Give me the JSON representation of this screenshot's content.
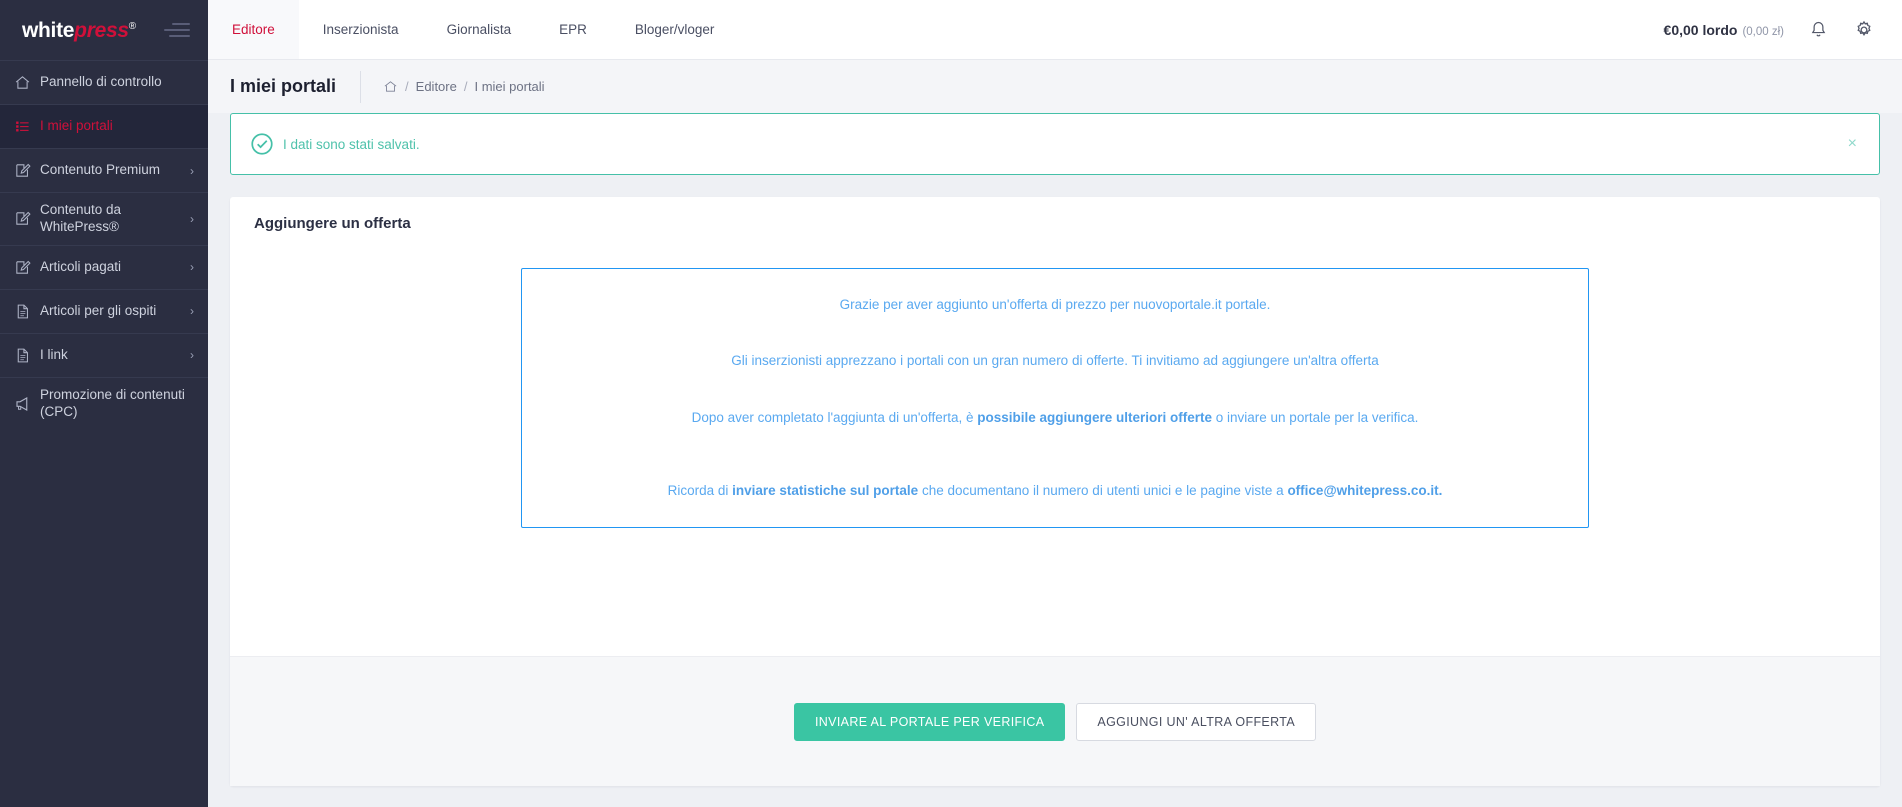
{
  "brand": {
    "name_white": "white",
    "name_red": "press",
    "reg": "®"
  },
  "sidebar": {
    "items": [
      {
        "label": "Pannello di controllo",
        "icon": "home-icon",
        "chevron": "",
        "active": false
      },
      {
        "label": "I miei portali",
        "icon": "list-icon",
        "chevron": "",
        "active": true
      },
      {
        "label": "Contenuto Premium",
        "icon": "edit-document-icon",
        "chevron": "›",
        "active": false
      },
      {
        "label": "Contenuto da WhitePress®",
        "icon": "edit-document-icon",
        "chevron": "›",
        "active": false
      },
      {
        "label": "Articoli pagati",
        "icon": "edit-document-icon",
        "chevron": "›",
        "active": false
      },
      {
        "label": "Articoli per gli ospiti",
        "icon": "document-icon",
        "chevron": "›",
        "active": false
      },
      {
        "label": "I link",
        "icon": "document-icon",
        "chevron": "›",
        "active": false
      },
      {
        "label": "Promozione di contenuti (CPC)",
        "icon": "megaphone-icon",
        "chevron": "",
        "active": false
      }
    ]
  },
  "topbar": {
    "tabs": [
      {
        "label": "Editore",
        "active": true
      },
      {
        "label": "Inserzionista",
        "active": false
      },
      {
        "label": "Giornalista",
        "active": false
      },
      {
        "label": "EPR",
        "active": false
      },
      {
        "label": "Bloger/vloger",
        "active": false
      }
    ],
    "balance": "€0,00 lordo",
    "balance_secondary": "(0,00 zł)",
    "bell_icon": "bell-icon",
    "gear_icon": "gear-icon"
  },
  "page": {
    "title": "I miei portali",
    "breadcrumb": {
      "home_icon": "home-icon",
      "sep": "/",
      "items": [
        "Editore",
        "I miei portali"
      ]
    }
  },
  "alert": {
    "icon": "check-circle-icon",
    "message": "I dati sono stati salvati.",
    "close": "×",
    "color": "#45c0a8"
  },
  "card": {
    "title": "Aggiungere un offerta",
    "info": {
      "border_color": "#2196f3",
      "line1": "Grazie per aver aggiunto un'offerta di prezzo per nuovoportale.it portale.",
      "line2": "Gli inserzionisti apprezzano i portali con un gran numero di offerte. Ti invitiamo ad aggiungere un'altra offerta",
      "line3_pre": "Dopo aver completato l'aggiunta di un'offerta, è ",
      "line3_bold": "possibile aggiungere ulteriori offerte",
      "line3_post": " o inviare un portale per la verifica.",
      "line4_pre": "Ricorda di ",
      "line4_bold": "inviare statistiche sul portale",
      "line4_mid": " che documentano il numero di utenti unici e le pagine viste a ",
      "line4_bold2": "office@whitepress.co.it."
    },
    "buttons": {
      "primary": "INVIARE AL PORTALE PER VERIFICA",
      "secondary": "AGGIUNGI UN' ALTRA OFFERTA",
      "primary_color": "#3ac5a3"
    }
  }
}
